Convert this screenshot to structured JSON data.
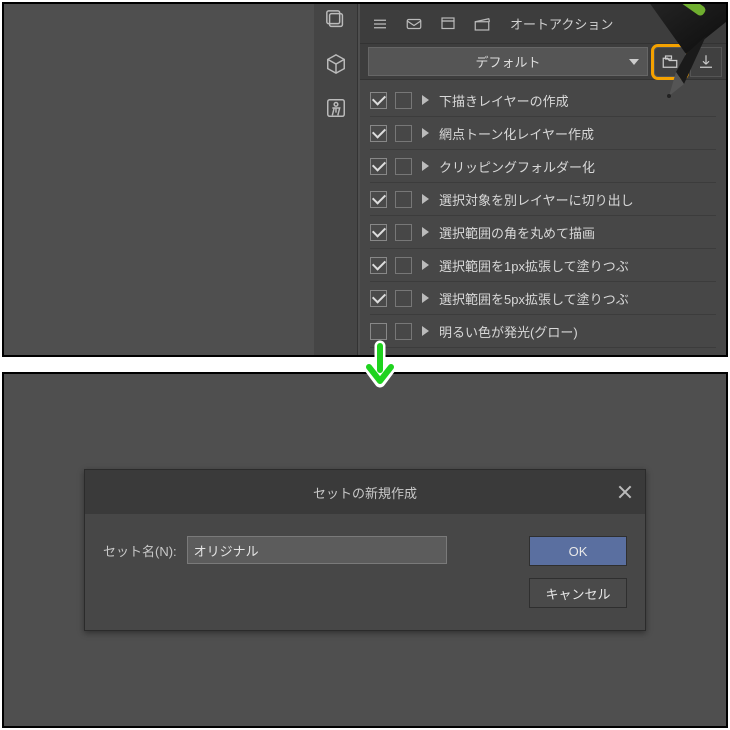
{
  "colors": {
    "highlight": "#f5a200",
    "arrow": "#1fd31f"
  },
  "tabbar": {
    "label": "オートアクション"
  },
  "set_dropdown": {
    "selected": "デフォルト"
  },
  "actions": [
    {
      "checked": true,
      "label": "下描きレイヤーの作成"
    },
    {
      "checked": true,
      "label": "網点トーン化レイヤー作成"
    },
    {
      "checked": true,
      "label": "クリッピングフォルダー化"
    },
    {
      "checked": true,
      "label": "選択対象を別レイヤーに切り出し"
    },
    {
      "checked": true,
      "label": "選択範囲の角を丸めて描画"
    },
    {
      "checked": true,
      "label": "選択範囲を1px拡張して塗りつぶ"
    },
    {
      "checked": true,
      "label": "選択範囲を5px拡張して塗りつぶ"
    },
    {
      "checked": false,
      "label": "明るい色が発光(グロー)"
    }
  ],
  "dialog": {
    "title": "セットの新規作成",
    "field_label": "セット名(N):",
    "value": "オリジナル",
    "ok": "OK",
    "cancel": "キャンセル"
  }
}
